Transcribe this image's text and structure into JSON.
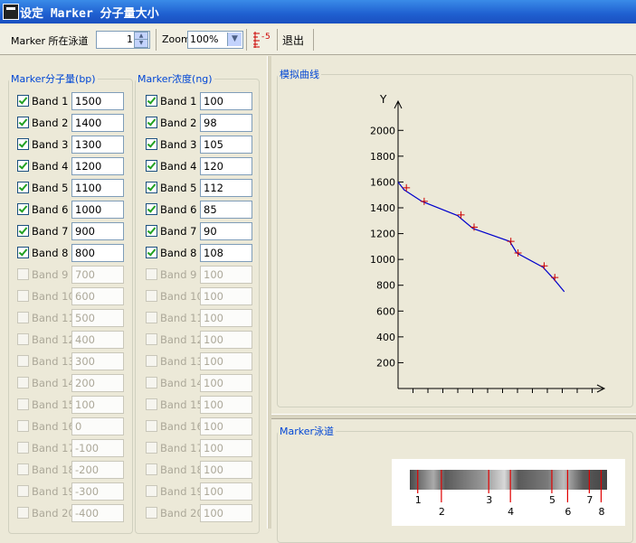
{
  "window": {
    "title": "设定 Marker 分子量大小"
  },
  "toolbar": {
    "lane_label": "Marker 所在泳道",
    "lane_value": "1",
    "zoom_label": "Zoom",
    "zoom_value": "100%",
    "ruler_number": "5",
    "exit_label": "退出"
  },
  "mw_group": {
    "legend": "Marker分子量(bp)",
    "bands": [
      {
        "label": "Band 1",
        "value": "1500",
        "checked": true
      },
      {
        "label": "Band 2",
        "value": "1400",
        "checked": true
      },
      {
        "label": "Band 3",
        "value": "1300",
        "checked": true
      },
      {
        "label": "Band 4",
        "value": "1200",
        "checked": true
      },
      {
        "label": "Band 5",
        "value": "1100",
        "checked": true
      },
      {
        "label": "Band 6",
        "value": "1000",
        "checked": true
      },
      {
        "label": "Band 7",
        "value": "900",
        "checked": true
      },
      {
        "label": "Band 8",
        "value": "800",
        "checked": true
      },
      {
        "label": "Band 9",
        "value": "700",
        "checked": false
      },
      {
        "label": "Band 10",
        "value": "600",
        "checked": false
      },
      {
        "label": "Band 11",
        "value": "500",
        "checked": false
      },
      {
        "label": "Band 12",
        "value": "400",
        "checked": false
      },
      {
        "label": "Band 13",
        "value": "300",
        "checked": false
      },
      {
        "label": "Band 14",
        "value": "200",
        "checked": false
      },
      {
        "label": "Band 15",
        "value": "100",
        "checked": false
      },
      {
        "label": "Band 16",
        "value": "0",
        "checked": false
      },
      {
        "label": "Band 17",
        "value": "-100",
        "checked": false
      },
      {
        "label": "Band 18",
        "value": "-200",
        "checked": false
      },
      {
        "label": "Band 19",
        "value": "-300",
        "checked": false
      },
      {
        "label": "Band 20",
        "value": "-400",
        "checked": false
      }
    ]
  },
  "conc_group": {
    "legend": "Marker浓度(ng)",
    "bands": [
      {
        "label": "Band 1",
        "value": "100",
        "checked": true
      },
      {
        "label": "Band 2",
        "value": "98",
        "checked": true
      },
      {
        "label": "Band 3",
        "value": "105",
        "checked": true
      },
      {
        "label": "Band 4",
        "value": "120",
        "checked": true
      },
      {
        "label": "Band 5",
        "value": "112",
        "checked": true
      },
      {
        "label": "Band 6",
        "value": "85",
        "checked": true
      },
      {
        "label": "Band 7",
        "value": "90",
        "checked": true
      },
      {
        "label": "Band 8",
        "value": "108",
        "checked": true
      },
      {
        "label": "Band 9",
        "value": "100",
        "checked": false
      },
      {
        "label": "Band 10",
        "value": "100",
        "checked": false
      },
      {
        "label": "Band 11",
        "value": "100",
        "checked": false
      },
      {
        "label": "Band 12",
        "value": "100",
        "checked": false
      },
      {
        "label": "Band 13",
        "value": "100",
        "checked": false
      },
      {
        "label": "Band 14",
        "value": "100",
        "checked": false
      },
      {
        "label": "Band 15",
        "value": "100",
        "checked": false
      },
      {
        "label": "Band 16",
        "value": "100",
        "checked": false
      },
      {
        "label": "Band 17",
        "value": "100",
        "checked": false
      },
      {
        "label": "Band 18",
        "value": "100",
        "checked": false
      },
      {
        "label": "Band 19",
        "value": "100",
        "checked": false
      },
      {
        "label": "Band 20",
        "value": "100",
        "checked": false
      }
    ]
  },
  "curve_group": {
    "legend": "模拟曲线",
    "y_label": "Y",
    "y_ticks": [
      "2000",
      "1800",
      "1600",
      "1400",
      "1200",
      "1000",
      "800",
      "600",
      "400",
      "200"
    ]
  },
  "chart_data": {
    "type": "line",
    "title": "",
    "ylabel": "Y",
    "xlabel": "",
    "ylim": [
      0,
      2100
    ],
    "x_tick_count": 13,
    "series": [
      {
        "color": "#0000cc",
        "x": [
          0,
          0.5,
          2,
          5,
          6.3,
          9.4,
          10,
          12.2,
          13.1,
          14
        ],
        "y": [
          1600,
          1540,
          1450,
          1340,
          1240,
          1140,
          1050,
          940,
          850,
          750
        ]
      }
    ],
    "markers": {
      "color": "#cc0000",
      "x": [
        0.7,
        2.2,
        5.3,
        6.4,
        9.5,
        10.1,
        12.3,
        13.2
      ],
      "y": [
        1555,
        1450,
        1345,
        1250,
        1140,
        1050,
        950,
        860
      ]
    }
  },
  "lane_group": {
    "legend": "Marker泳道",
    "band_numbers": [
      "1",
      "2",
      "3",
      "4",
      "5",
      "6",
      "7",
      "8"
    ],
    "band_positions": [
      0.04,
      0.16,
      0.4,
      0.51,
      0.72,
      0.8,
      0.91,
      0.97
    ],
    "band_color": "#e00000"
  }
}
